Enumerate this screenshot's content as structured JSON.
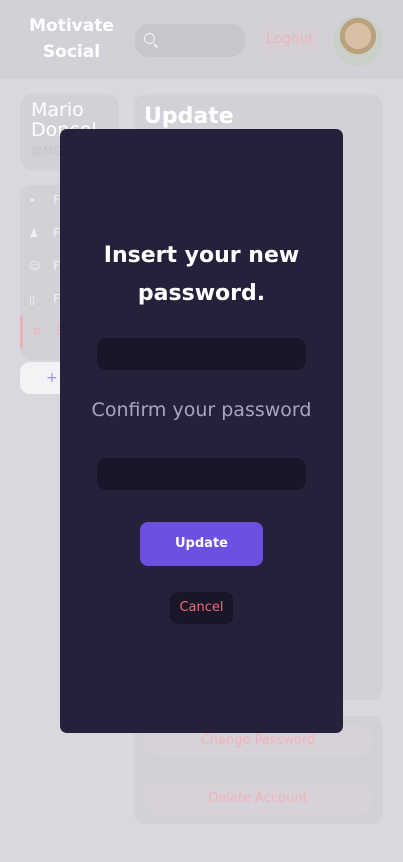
{
  "header": {
    "brand": "Motivate Social",
    "logout_label": "Logout"
  },
  "profile": {
    "name": "Mario Doncel",
    "handle": "@MD"
  },
  "sidebar": {
    "items": [
      {
        "icon": "rss-icon",
        "label": "F"
      },
      {
        "icon": "people-icon",
        "label": "F"
      },
      {
        "icon": "user-icon",
        "label": "F"
      },
      {
        "icon": "document-icon",
        "label": "F"
      },
      {
        "icon": "gear-icon",
        "label": "S"
      }
    ],
    "add_label": "+"
  },
  "main": {
    "title": "Update"
  },
  "settings": {
    "change_password_label": "Change Password",
    "delete_account_label": "Delete Account"
  },
  "modal": {
    "title": "Insert your new password.",
    "new_password_value": "",
    "confirm_label": "Confirm your password",
    "confirm_password_value": "",
    "update_label": "Update",
    "cancel_label": "Cancel"
  },
  "colors": {
    "modal_bg": "#25213b",
    "input_bg": "#19162a",
    "accent": "#6d4fe1",
    "cancel_text": "#f16a73"
  }
}
